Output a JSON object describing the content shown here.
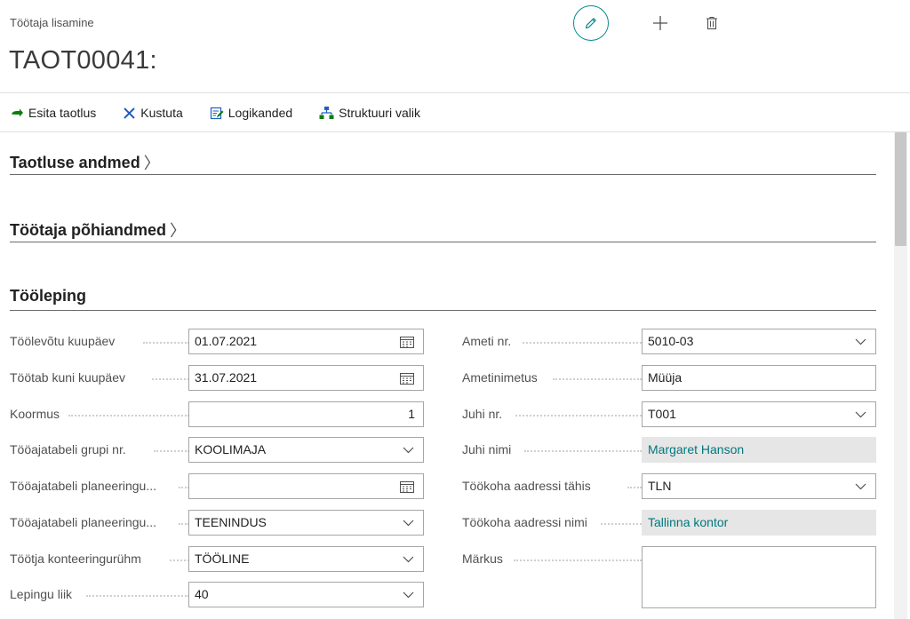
{
  "header": {
    "caption": "Töötaja lisamine",
    "title": "TAOT00041:"
  },
  "top_actions": {
    "edit_icon": "pencil-icon",
    "new_icon": "plus-icon",
    "delete_icon": "trash-icon"
  },
  "actions": [
    {
      "label": "Esita taotlus",
      "icon": "arrow-right-icon"
    },
    {
      "label": "Kustuta",
      "icon": "x-icon"
    },
    {
      "label": "Logikanded",
      "icon": "log-edit-icon"
    },
    {
      "label": "Struktuuri valik",
      "icon": "hierarchy-icon"
    }
  ],
  "sections": {
    "taotluse": "Taotluse andmed",
    "pohiandmed": "Töötaja põhiandmed",
    "tooleping": "Tööleping"
  },
  "left_fields": [
    {
      "label": "Töölevõtu kuupäev",
      "value": "01.07.2021",
      "control": "date"
    },
    {
      "label": "Töötab kuni kuupäev",
      "value": "31.07.2021",
      "control": "date"
    },
    {
      "label": "Koormus",
      "value": "1",
      "control": "number"
    },
    {
      "label": "Tööajatabeli grupi nr.",
      "value": "KOOLIMAJA",
      "control": "dropdown"
    },
    {
      "label": "Tööajatabeli planeeringu...",
      "value": "",
      "control": "date"
    },
    {
      "label": "Tööajatabeli planeeringu...",
      "value": "TEENINDUS",
      "control": "dropdown"
    },
    {
      "label": "Töötja konteeringurühm",
      "value": "TÖÖLINE",
      "control": "dropdown"
    },
    {
      "label": "Lepingu liik",
      "value": "40",
      "control": "dropdown"
    }
  ],
  "right_fields": [
    {
      "label": "Ameti nr.",
      "value": "5010-03",
      "control": "dropdown"
    },
    {
      "label": "Ametinimetus",
      "value": "Müüja",
      "control": "text"
    },
    {
      "label": "Juhi nr.",
      "value": "T001",
      "control": "dropdown"
    },
    {
      "label": "Juhi nimi",
      "value": "Margaret Hanson",
      "control": "readonly"
    },
    {
      "label": "Töökoha aadressi tähis",
      "value": "TLN",
      "control": "dropdown"
    },
    {
      "label": "Töökoha aadressi nimi",
      "value": "Tallinna kontor",
      "control": "readonly"
    },
    {
      "label": "Märkus",
      "value": "",
      "control": "multiline"
    }
  ],
  "colors": {
    "accent": "#0a8a8f",
    "action_green": "#107c10",
    "action_blue": "#1f5fbf",
    "readonly_bg": "#e6e6e6",
    "link_teal": "#00787e"
  }
}
